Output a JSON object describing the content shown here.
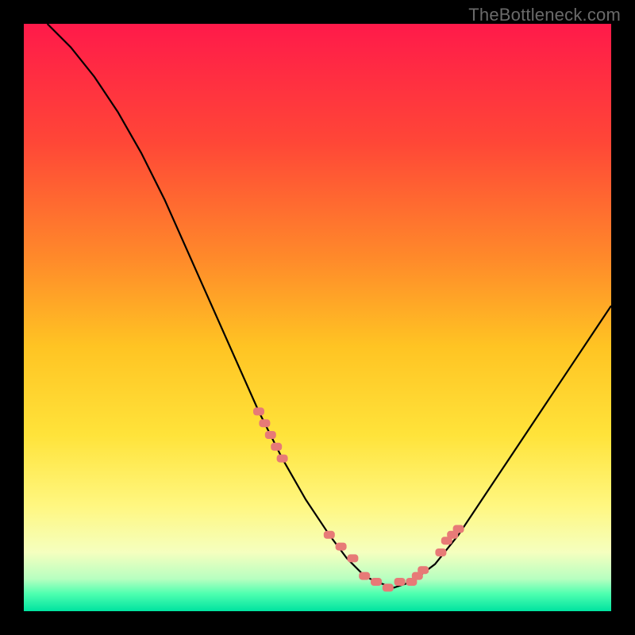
{
  "watermark": "TheBottleneck.com",
  "chart_data": {
    "type": "line",
    "title": "",
    "xlabel": "",
    "ylabel": "",
    "xlim": [
      0,
      100
    ],
    "ylim": [
      0,
      100
    ],
    "background_gradient": {
      "type": "vertical",
      "stops": [
        {
          "pos": 0.0,
          "color": "#ff1a4a"
        },
        {
          "pos": 0.2,
          "color": "#ff4637"
        },
        {
          "pos": 0.4,
          "color": "#ff8a2a"
        },
        {
          "pos": 0.55,
          "color": "#ffc423"
        },
        {
          "pos": 0.7,
          "color": "#ffe33a"
        },
        {
          "pos": 0.82,
          "color": "#fff780"
        },
        {
          "pos": 0.9,
          "color": "#f5ffbf"
        },
        {
          "pos": 0.945,
          "color": "#b7ffc0"
        },
        {
          "pos": 0.97,
          "color": "#4fffb0"
        },
        {
          "pos": 1.0,
          "color": "#00e3a0"
        }
      ]
    },
    "series": [
      {
        "name": "bottleneck-curve",
        "x": [
          4,
          8,
          12,
          16,
          20,
          24,
          28,
          32,
          36,
          40,
          44,
          48,
          52,
          55,
          58,
          60,
          63,
          66,
          70,
          74,
          78,
          82,
          86,
          90,
          94,
          98,
          100
        ],
        "y": [
          100,
          96,
          91,
          85,
          78,
          70,
          61,
          52,
          43,
          34,
          26,
          19,
          13,
          9,
          6,
          5,
          4,
          5,
          8,
          13,
          19,
          25,
          31,
          37,
          43,
          49,
          52
        ]
      }
    ],
    "markers": {
      "name": "highlighted-points",
      "color": "#e77a77",
      "x": [
        40,
        41,
        42,
        43,
        44,
        52,
        54,
        56,
        58,
        60,
        62,
        64,
        66,
        67,
        68,
        71,
        72,
        73,
        74
      ],
      "y": [
        34,
        32,
        30,
        28,
        26,
        13,
        11,
        9,
        6,
        5,
        4,
        5,
        5,
        6,
        7,
        10,
        12,
        13,
        14
      ]
    }
  }
}
